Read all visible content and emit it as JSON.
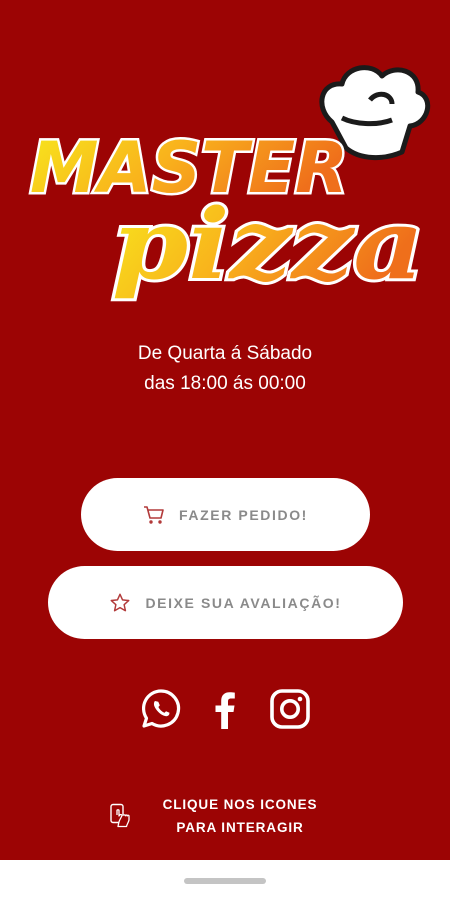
{
  "logo": {
    "line1": "MASTER",
    "line2": "pizza"
  },
  "schedule": {
    "days": "De Quarta á Sábado",
    "time": "das 18:00 ás 00:00"
  },
  "buttons": {
    "order": {
      "label": "FAZER PEDIDO!",
      "icon": "shopping-cart-icon"
    },
    "review": {
      "label": "DEIXE SUA AVALIAÇÃO!",
      "icon": "star-icon"
    }
  },
  "social": [
    "whatsapp-icon",
    "facebook-icon",
    "instagram-icon"
  ],
  "hint": {
    "line1": "CLIQUE NOS ICONES",
    "line2": "PARA INTERAGIR",
    "icon": "tap-icon"
  },
  "colors": {
    "background": "#9c0404",
    "button_bg": "#ffffff",
    "button_text": "#8a8a8a",
    "icon_accent": "#b23a3a"
  }
}
